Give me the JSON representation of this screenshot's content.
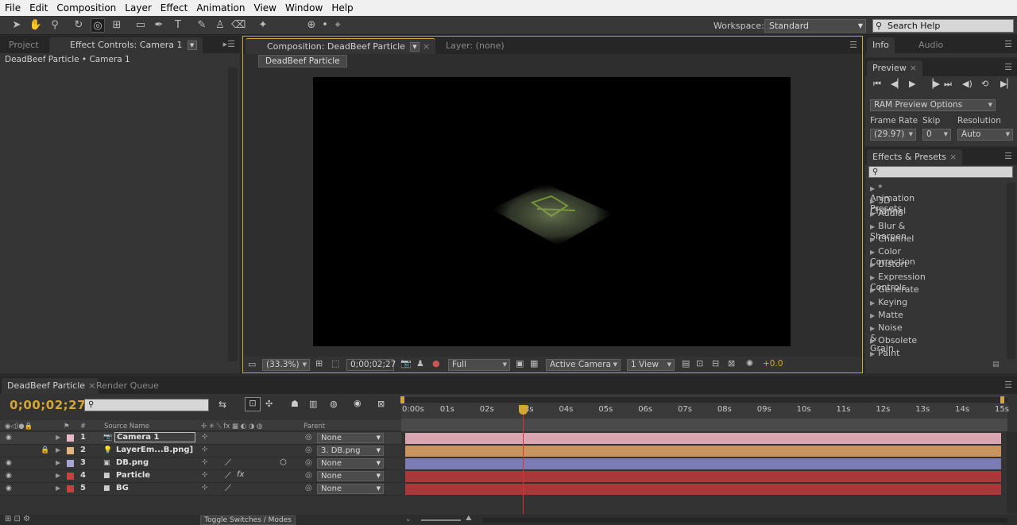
{
  "menu": [
    "File",
    "Edit",
    "Composition",
    "Layer",
    "Effect",
    "Animation",
    "View",
    "Window",
    "Help"
  ],
  "workspace": {
    "label": "Workspace:",
    "value": "Standard"
  },
  "search_help": "Search Help",
  "left_panel": {
    "tabs": [
      "Project",
      "Effect Controls: Camera 1"
    ],
    "breadcrumb": "DeadBeef Particle • Camera 1"
  },
  "comp_panel": {
    "tabs": [
      "Composition: DeadBeef Particle",
      "Layer: (none)"
    ],
    "sub_tab": "DeadBeef Particle",
    "zoom": "(33.3%)",
    "timecode": "0;00;02;27",
    "resolution": "Full",
    "camera": "Active Camera",
    "views": "1 View",
    "exposure": "+0.0"
  },
  "info_panel": {
    "tabs": [
      "Info",
      "Audio"
    ]
  },
  "preview_panel": {
    "title": "Preview",
    "ram_options": "RAM Preview Options",
    "frame_rate_label": "Frame Rate",
    "skip_label": "Skip",
    "resolution_label": "Resolution",
    "frame_rate": "(29.97)",
    "skip": "0",
    "resolution": "Auto"
  },
  "effects_panel": {
    "title": "Effects & Presets",
    "items": [
      "* Animation Presets",
      "3D Channel",
      "Audio",
      "Blur & Sharpen",
      "Channel",
      "Color Correction",
      "Distort",
      "Expression Controls",
      "Generate",
      "Keying",
      "Matte",
      "Noise & Grain",
      "Obsolete",
      "Paint"
    ]
  },
  "timeline": {
    "tabs": [
      "DeadBeef Particle",
      "Render Queue"
    ],
    "timecode": "0;00;02;27",
    "columns": {
      "num": "#",
      "source": "Source Name",
      "parent": "Parent"
    },
    "ruler": [
      "0:00s",
      "01s",
      "02s",
      "03s",
      "04s",
      "05s",
      "06s",
      "07s",
      "08s",
      "09s",
      "10s",
      "11s",
      "12s",
      "13s",
      "14s",
      "15s"
    ],
    "playhead_fraction": 0.195,
    "layers": [
      {
        "num": "1",
        "name": "Camera 1",
        "parent": "None",
        "label_color": "#e7b8c6",
        "bar_color": "#d8a5b1"
      },
      {
        "num": "2",
        "name": "LayerEm...B.png]",
        "parent": "3. DB.png",
        "label_color": "#e5b57f",
        "bar_color": "#c9955c"
      },
      {
        "num": "3",
        "name": "DB.png",
        "parent": "None",
        "label_color": "#a5a5d8",
        "bar_color": "#7d7bb3"
      },
      {
        "num": "4",
        "name": "Particle",
        "parent": "None",
        "label_color": "#c84040",
        "bar_color": "#a93939"
      },
      {
        "num": "5",
        "name": "BG",
        "parent": "None",
        "label_color": "#c84040",
        "bar_color": "#a93939"
      }
    ],
    "toggle": "Toggle Switches / Modes"
  },
  "colors": {
    "accent": "#d3a734",
    "timecode": "#d3a734",
    "playhead": "#e03030"
  }
}
